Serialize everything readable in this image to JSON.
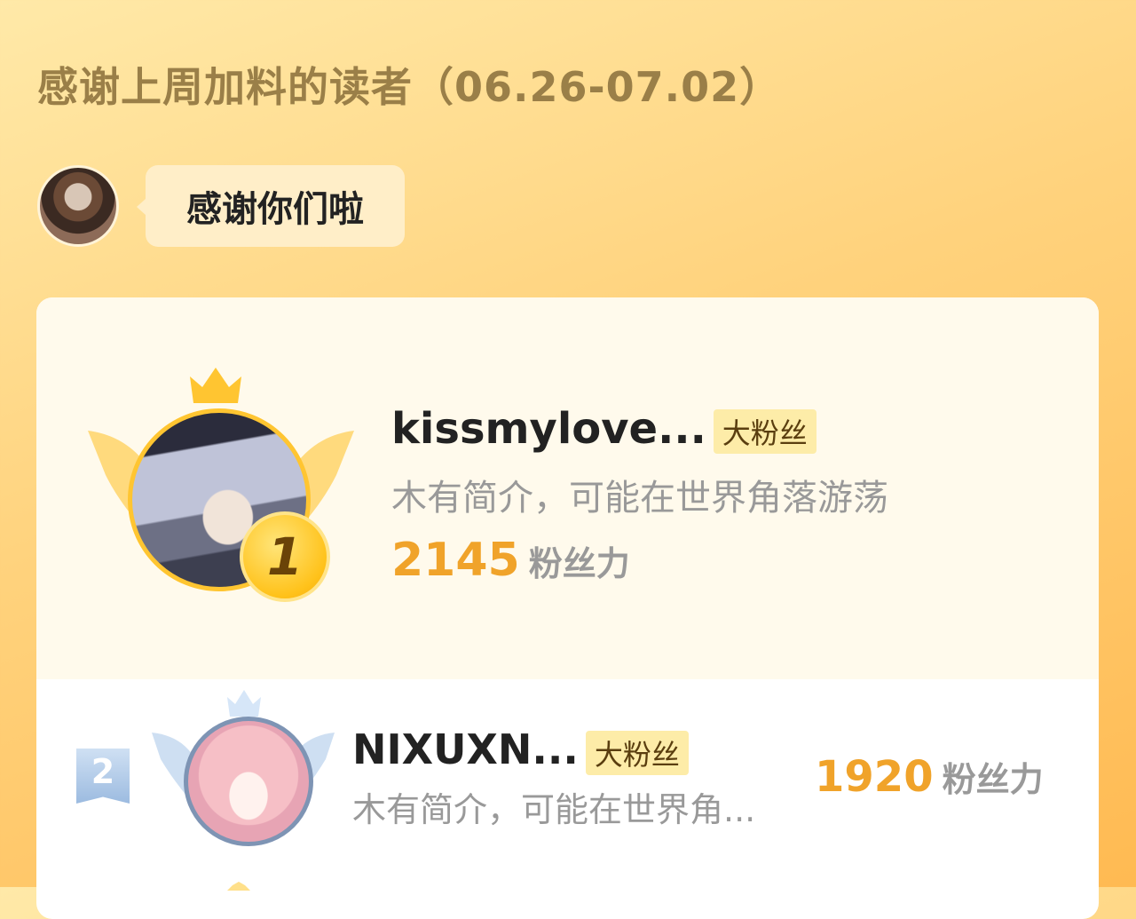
{
  "header": {
    "title": "感谢上周加料的读者（06.26-07.02）",
    "bubble_text": "感谢你们啦"
  },
  "ranking": [
    {
      "rank": "1",
      "name": "kissmylove...",
      "badge": "大粉丝",
      "description": "木有简介，可能在世界角落游荡",
      "fans_value": "2145",
      "fans_label": "粉丝力"
    },
    {
      "rank": "2",
      "name": "NIXUXN...",
      "badge": "大粉丝",
      "description": "木有简介，可能在世界角...",
      "fans_value": "1920",
      "fans_label": "粉丝力"
    }
  ],
  "colors": {
    "accent": "#f0a32a",
    "title": "#9a7f48",
    "badge_bg": "#fdeca8",
    "rank2_ribbon": "#9cbbe0"
  },
  "icons": [
    "crown-icon",
    "wing-icon",
    "rank-medal-icon",
    "rank-ribbon-icon"
  ]
}
